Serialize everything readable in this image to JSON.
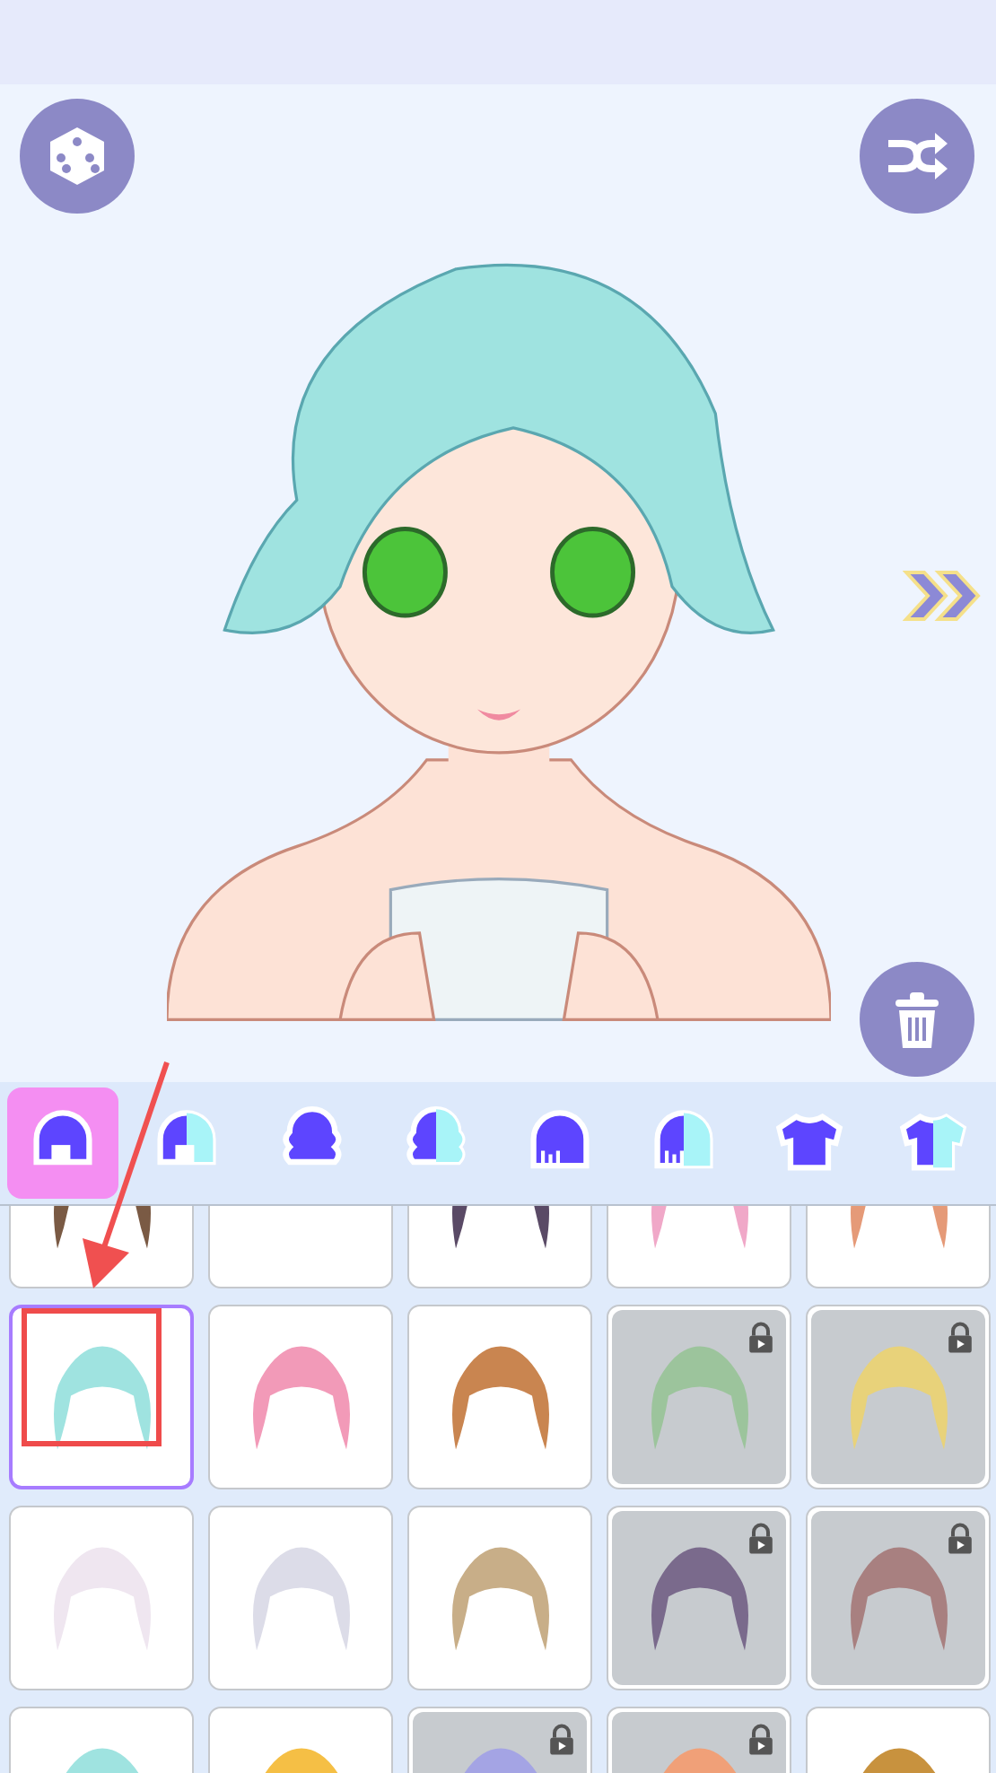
{
  "toolbar": {
    "buttons": [
      {
        "kind": "dice"
      },
      {
        "kind": "shuffle"
      },
      {
        "kind": "next"
      },
      {
        "kind": "trash"
      }
    ]
  },
  "tabs": [
    {
      "kind": "bob",
      "two_tone": false,
      "selected": true
    },
    {
      "kind": "bob",
      "two_tone": true,
      "selected": false
    },
    {
      "kind": "curly",
      "two_tone": false,
      "selected": false
    },
    {
      "kind": "curly",
      "two_tone": true,
      "selected": false
    },
    {
      "kind": "straight",
      "two_tone": false,
      "selected": false
    },
    {
      "kind": "straight",
      "two_tone": true,
      "selected": false
    },
    {
      "kind": "shirt",
      "two_tone": false,
      "selected": false
    },
    {
      "kind": "shirt",
      "two_tone": true,
      "selected": false
    }
  ],
  "items": [
    {
      "kind": "hair",
      "color": "#7a5a44",
      "locked": false,
      "selected": false
    },
    {
      "kind": "empty",
      "locked": false,
      "selected": false
    },
    {
      "kind": "hair",
      "color": "#5a4a66",
      "locked": false,
      "selected": false
    },
    {
      "kind": "hair",
      "color": "#f0a8c8",
      "locked": false,
      "selected": false
    },
    {
      "kind": "hair",
      "color": "#e59a78",
      "locked": false,
      "selected": false
    },
    {
      "kind": "hair",
      "color": "#9fe3e0",
      "locked": false,
      "selected": true
    },
    {
      "kind": "hair",
      "color": "#f29ab8",
      "locked": false,
      "selected": false
    },
    {
      "kind": "hair",
      "color": "#c98550",
      "locked": false,
      "selected": false
    },
    {
      "kind": "hair",
      "color": "#9cc49c",
      "locked": true,
      "selected": false
    },
    {
      "kind": "hair",
      "color": "#e8d27a",
      "locked": true,
      "selected": false
    },
    {
      "kind": "hair",
      "color": "#efe6f0",
      "locked": false,
      "selected": false
    },
    {
      "kind": "hair",
      "color": "#dcdce8",
      "locked": false,
      "selected": false
    },
    {
      "kind": "hair",
      "color": "#c8ae88",
      "locked": false,
      "selected": false
    },
    {
      "kind": "hair",
      "color": "#7a6a8c",
      "locked": true,
      "selected": false
    },
    {
      "kind": "hair",
      "color": "#a88080",
      "locked": true,
      "selected": false
    },
    {
      "kind": "hair",
      "color": "#9fe3e0",
      "locked": false,
      "selected": false
    },
    {
      "kind": "hair",
      "color": "#f5bf45",
      "locked": false,
      "selected": false
    },
    {
      "kind": "hair",
      "color": "#a4a4e4",
      "locked": true,
      "selected": false
    },
    {
      "kind": "hair",
      "color": "#f0a078",
      "locked": true,
      "selected": false
    },
    {
      "kind": "hair",
      "color": "#c8923e",
      "locked": false,
      "selected": false
    }
  ]
}
